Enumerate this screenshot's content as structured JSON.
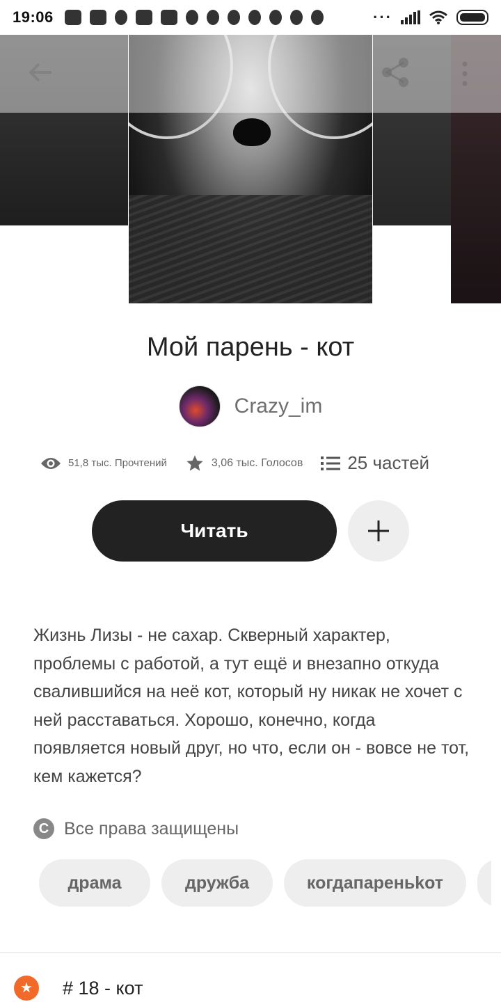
{
  "status_bar": {
    "time": "19:06",
    "overflow": "···"
  },
  "story": {
    "title": "Мой парень - кот",
    "author": "Crazy_im",
    "stats": {
      "reads": "51,8 тыс. Прочтений",
      "votes": "3,06 тыс. Голосов",
      "parts": "25 частей"
    },
    "read_button_label": "Читать",
    "description": "Жизнь Лизы - не сахар. Скверный характер, проблемы с работой, а тут ещё и внезапно откуда свалившийся на неё кот, который ну никак не хочет с ней расставаться. Хорошо, конечно, когда появляется новый друг, но что, если он - вовсе не тот, кем кажется?",
    "copyright_symbol": "C",
    "copyright": "Все права защищены",
    "tags": [
      "драма",
      "дружба",
      "когдапареньkот"
    ],
    "rank": "# 18 - кот"
  },
  "icons": {
    "back": "arrow-left",
    "share": "share",
    "menu": "more-vertical",
    "views": "eye",
    "votes": "star",
    "parts": "list",
    "add": "plus",
    "rank": "star-badge"
  },
  "colors": {
    "primary_button": "#222222",
    "secondary_button": "#eeeeee",
    "rank_badge": "#f26a2a",
    "muted_text": "#666666"
  }
}
